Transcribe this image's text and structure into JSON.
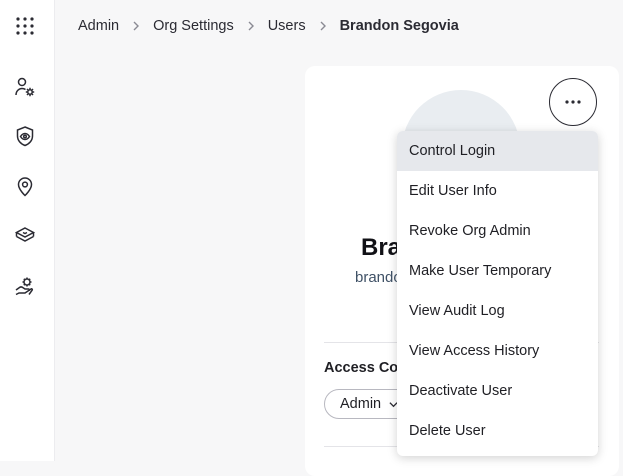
{
  "sidebar": {
    "items": [
      {
        "icon": "grid-icon"
      },
      {
        "icon": "users-gear-icon"
      },
      {
        "icon": "shield-eye-icon"
      },
      {
        "icon": "location-pin-icon"
      },
      {
        "icon": "layers-box-icon"
      },
      {
        "icon": "hand-gear-icon"
      }
    ]
  },
  "breadcrumb": {
    "items": [
      "Admin",
      "Org Settings",
      "Users",
      "Brandon Segovia"
    ]
  },
  "profile": {
    "name_visible": "Bra",
    "email_visible": "brando"
  },
  "access_control": {
    "label_visible": "Access Con",
    "role_value": "Admin"
  },
  "menu": {
    "items": [
      "Control Login",
      "Edit User Info",
      "Revoke Org Admin",
      "Make User Temporary",
      "View Audit Log",
      "View Access History",
      "Deactivate User",
      "Delete User"
    ],
    "highlighted_index": 0
  },
  "colors": {
    "menu_highlight": "#e6e8ec",
    "avatar_bg": "#e9edf1",
    "email_text": "#3f5166"
  }
}
